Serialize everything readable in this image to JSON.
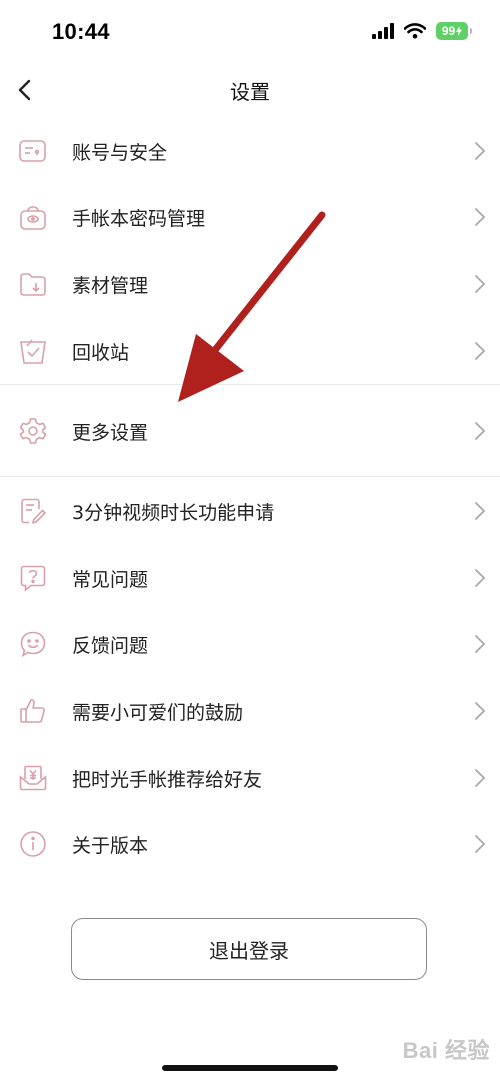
{
  "status_bar": {
    "time": "10:44",
    "battery": "99"
  },
  "nav": {
    "title": "设置"
  },
  "settings": {
    "group1": [
      {
        "label": "账号与安全",
        "icon": "id-card-heart-icon"
      },
      {
        "label": "手帐本密码管理",
        "icon": "lock-box-icon"
      },
      {
        "label": "素材管理",
        "icon": "folder-download-icon"
      },
      {
        "label": "回收站",
        "icon": "trash-bin-icon"
      }
    ],
    "group2": [
      {
        "label": "更多设置",
        "icon": "gear-icon"
      }
    ],
    "group3": [
      {
        "label": "3分钟视频时长功能申请",
        "icon": "document-edit-icon"
      },
      {
        "label": "常见问题",
        "icon": "question-icon"
      },
      {
        "label": "反馈问题",
        "icon": "smile-bubble-icon"
      },
      {
        "label": "需要小可爱们的鼓励",
        "icon": "thumbs-up-icon"
      },
      {
        "label": "把时光手帐推荐给好友",
        "icon": "share-gift-icon"
      },
      {
        "label": "关于版本",
        "icon": "info-icon"
      }
    ]
  },
  "logout": {
    "label": "退出登录"
  },
  "colors": {
    "icon_accent": "#d9a0aa",
    "annotation_arrow": "#b0201c"
  },
  "watermark": {
    "text": "Bai 经验"
  }
}
